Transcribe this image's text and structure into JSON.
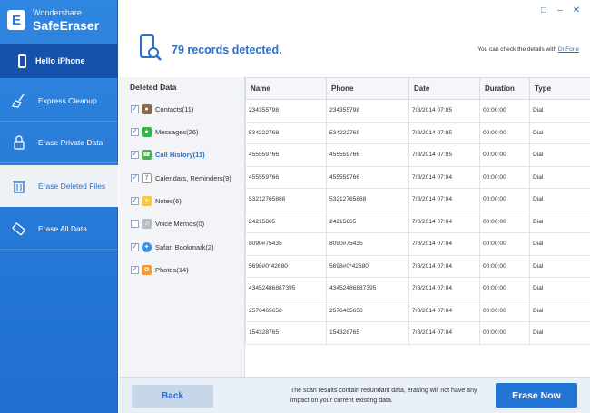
{
  "brand": {
    "vendor": "Wondershare",
    "product": "SafeEraser"
  },
  "device": {
    "greeting": "Hello iPhone"
  },
  "sidebar": {
    "items": [
      {
        "label": "Express Cleanup"
      },
      {
        "label": "Erase Private Data"
      },
      {
        "label": "Erase Deleted Files"
      },
      {
        "label": "Erase All Data"
      }
    ]
  },
  "header": {
    "records": "79 records detected.",
    "details_prefix": "You can check the details with ",
    "details_link": "Dr.Fone"
  },
  "deleted": {
    "title": "Deleted Data",
    "categories": [
      {
        "label": "Contacts(11)",
        "checked": true
      },
      {
        "label": "Messages(26)",
        "checked": true
      },
      {
        "label": "Call History(11)",
        "checked": true
      },
      {
        "label": "Calendars, Reminders(9)",
        "checked": true
      },
      {
        "label": "Notes(6)",
        "checked": true
      },
      {
        "label": "Voice Memos(0)",
        "checked": false
      },
      {
        "label": "Safari Bookmark(2)",
        "checked": true
      },
      {
        "label": "Photos(14)",
        "checked": true
      }
    ]
  },
  "table": {
    "headers": [
      "Name",
      "Phone",
      "Date",
      "Duration",
      "Type"
    ],
    "rows": [
      [
        "234355798",
        "234355798",
        "7/8/2014 07:05",
        "00:00:00",
        "Dial"
      ],
      [
        "534222768",
        "534222768",
        "7/8/2014 07:05",
        "00:00:00",
        "Dial"
      ],
      [
        "455559766",
        "455559766",
        "7/8/2014 07:05",
        "00:00:00",
        "Dial"
      ],
      [
        "455559766",
        "455559766",
        "7/8/2014 07:04",
        "00:00:00",
        "Dial"
      ],
      [
        "53212765868",
        "53212765868",
        "7/8/2014 07:04",
        "00:00:00",
        "Dial"
      ],
      [
        "24215865",
        "24215865",
        "7/8/2014 07:04",
        "00:00:00",
        "Dial"
      ],
      [
        "8090#75435",
        "8090#75435",
        "7/8/2014 07:04",
        "00:00:00",
        "Dial"
      ],
      [
        "5698#0*42680",
        "5698#0*42680",
        "7/8/2014 07:04",
        "00:00:00",
        "Dial"
      ],
      [
        "43452486887395",
        "43452486887395",
        "7/8/2014 07:04",
        "00:00:00",
        "Dial"
      ],
      [
        "2576465658",
        "2576465658",
        "7/8/2014 07:04",
        "00:00:00",
        "Dial"
      ],
      [
        "154328765",
        "154328765",
        "7/8/2014 07:04",
        "00:00:00",
        "Dial"
      ]
    ]
  },
  "footer": {
    "back": "Back",
    "note": "The scan results contain redundant data, erasing will not have any impact on your current existing data.",
    "erase": "Erase Now"
  },
  "colors": {
    "accent": "#2a6fc9",
    "sidebar": "#2379d8",
    "active_bg": "#1652ac"
  }
}
